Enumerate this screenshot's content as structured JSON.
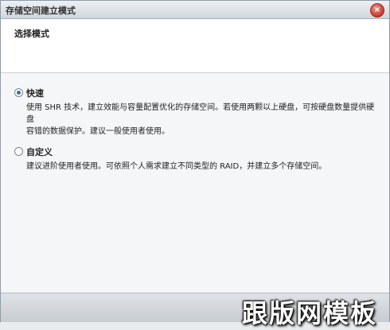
{
  "window": {
    "title": "存储空间建立模式",
    "close_glyph": "×"
  },
  "header": {
    "title": "选择模式"
  },
  "options": [
    {
      "label": "快速",
      "selected": true,
      "description_line1": "使用 SHR 技术，建立效能与容量配置优化的存储空间。若使用两颗以上硬盘，可按硬盘数量提供硬盘",
      "description_line2": "容错的数据保护。建议一般使用者使用。"
    },
    {
      "label": "自定义",
      "selected": false,
      "description_line1": "建议进阶使用者使用。可依照个人需求建立不同类型的 RAID，并建立多个存储空间。"
    }
  ],
  "watermark": {
    "text": "跟版网模板"
  }
}
